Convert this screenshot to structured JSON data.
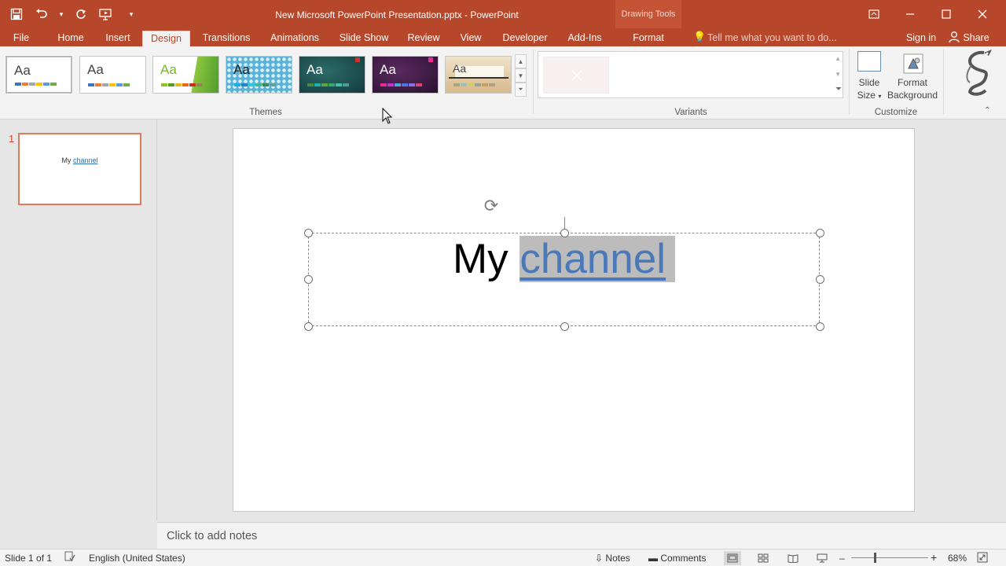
{
  "window": {
    "title": "New Microsoft PowerPoint Presentation.pptx - PowerPoint",
    "contextual_group": "Drawing Tools"
  },
  "qat": {
    "save_icon": "save-icon",
    "undo_icon": "undo-icon",
    "redo_icon": "redo-icon",
    "present_icon": "present-icon",
    "customize_icon": "chevron-down-icon"
  },
  "tabs": [
    {
      "label": "File"
    },
    {
      "label": "Home"
    },
    {
      "label": "Insert"
    },
    {
      "label": "Design"
    },
    {
      "label": "Transitions"
    },
    {
      "label": "Animations"
    },
    {
      "label": "Slide Show"
    },
    {
      "label": "Review"
    },
    {
      "label": "View"
    },
    {
      "label": "Developer"
    },
    {
      "label": "Add-Ins"
    },
    {
      "label": "Format"
    }
  ],
  "active_tab": "Design",
  "tell_me": {
    "placeholder": "Tell me what you want to do..."
  },
  "account": {
    "sign_in": "Sign in",
    "share": "Share"
  },
  "ribbon": {
    "themes": {
      "label": "Themes",
      "items": [
        {
          "aa": "Aa",
          "colors": [
            "#4472c4",
            "#ed7d31",
            "#a5a5a5",
            "#ffc000",
            "#5b9bd5",
            "#70ad47"
          ]
        },
        {
          "aa": "Aa",
          "colors": [
            "#4472c4",
            "#ed7d31",
            "#a5a5a5",
            "#ffc000",
            "#5b9bd5",
            "#70ad47"
          ]
        },
        {
          "aa": "Aa",
          "colors": [
            "#90c226",
            "#54a021",
            "#e6b91e",
            "#e76618",
            "#c42f1a",
            "#918655"
          ]
        },
        {
          "aa": "Aa",
          "colors": [
            "#1cade4",
            "#2683c6",
            "#27ced7",
            "#42ba97",
            "#3e8853",
            "#62a39f"
          ]
        },
        {
          "aa": "Aa",
          "colors": [
            "#4e8542",
            "#1fb2b0",
            "#63a537",
            "#37a76f",
            "#44c1a3",
            "#4e9a97"
          ]
        },
        {
          "aa": "Aa",
          "colors": [
            "#e32d91",
            "#c830cc",
            "#4ea6dc",
            "#4775e7",
            "#8971e1",
            "#d54773"
          ]
        },
        {
          "aa": "Aa",
          "colors": [
            "#a9a57c",
            "#9cbebd",
            "#d2cb6c",
            "#95a39d",
            "#c89f5d",
            "#b1a089"
          ]
        }
      ]
    },
    "variants": {
      "label": "Variants"
    },
    "customize": {
      "label": "Customize",
      "slide_size": "Slide Size",
      "format_background": "Format Background"
    }
  },
  "slides_panel": {
    "number": "1",
    "thumb_text_a": "My ",
    "thumb_text_b": "channel"
  },
  "slide": {
    "title_part1": "My ",
    "title_part2": "channel"
  },
  "notes": {
    "placeholder": "Click to add notes"
  },
  "status": {
    "slide_of": "Slide 1 of 1",
    "language": "English (United States)",
    "notes_btn": "Notes",
    "comments_btn": "Comments",
    "zoom": "68%",
    "zoom_minus": "–",
    "zoom_plus": "+"
  }
}
